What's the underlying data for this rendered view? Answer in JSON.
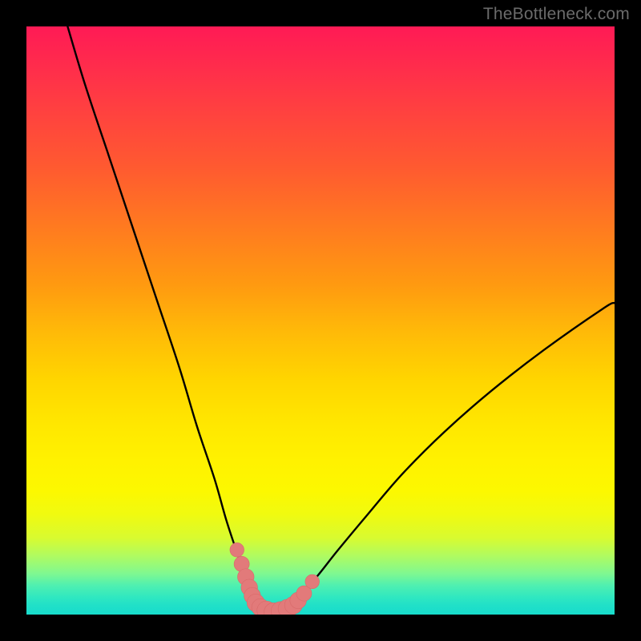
{
  "watermark": "TheBottleneck.com",
  "colors": {
    "frame": "#000000",
    "curve_stroke": "#000000",
    "marker_fill": "#e27a7a",
    "marker_stroke": "#d86a6a"
  },
  "chart_data": {
    "type": "line",
    "title": "",
    "xlabel": "",
    "ylabel": "",
    "xlim": [
      0,
      100
    ],
    "ylim": [
      0,
      100
    ],
    "description": "Bottleneck-style V-curve (two branches) reaching near-zero around x≈40, overlaid on a vertical red→green performance gradient. A cluster of salmon markers sits near the minimum on both branches.",
    "series": [
      {
        "name": "left-branch",
        "x": [
          7,
          10,
          14,
          18,
          22,
          26,
          29,
          32,
          34,
          36,
          37.5,
          39,
          40.5,
          42
        ],
        "y": [
          100,
          90,
          78,
          66,
          54,
          42,
          32,
          23,
          16,
          10,
          6,
          3,
          1.2,
          0.4
        ]
      },
      {
        "name": "right-branch",
        "x": [
          42,
          44,
          46,
          49,
          53,
          58,
          64,
          71,
          79,
          88,
          98,
          100
        ],
        "y": [
          0.4,
          1.2,
          3,
          6,
          11,
          17,
          24,
          31,
          38,
          45,
          52,
          53
        ]
      }
    ],
    "markers": [
      {
        "x": 35.8,
        "y": 11.0,
        "r": 1.2
      },
      {
        "x": 36.6,
        "y": 8.6,
        "r": 1.3
      },
      {
        "x": 37.3,
        "y": 6.4,
        "r": 1.4
      },
      {
        "x": 37.9,
        "y": 4.6,
        "r": 1.4
      },
      {
        "x": 38.4,
        "y": 3.2,
        "r": 1.4
      },
      {
        "x": 39.0,
        "y": 2.0,
        "r": 1.5
      },
      {
        "x": 39.8,
        "y": 1.2,
        "r": 1.5
      },
      {
        "x": 40.8,
        "y": 0.7,
        "r": 1.6
      },
      {
        "x": 42.0,
        "y": 0.4,
        "r": 1.6
      },
      {
        "x": 43.2,
        "y": 0.6,
        "r": 1.6
      },
      {
        "x": 44.4,
        "y": 1.0,
        "r": 1.6
      },
      {
        "x": 45.4,
        "y": 1.6,
        "r": 1.5
      },
      {
        "x": 46.2,
        "y": 2.4,
        "r": 1.4
      },
      {
        "x": 47.2,
        "y": 3.6,
        "r": 1.3
      },
      {
        "x": 48.6,
        "y": 5.6,
        "r": 1.2
      }
    ]
  }
}
